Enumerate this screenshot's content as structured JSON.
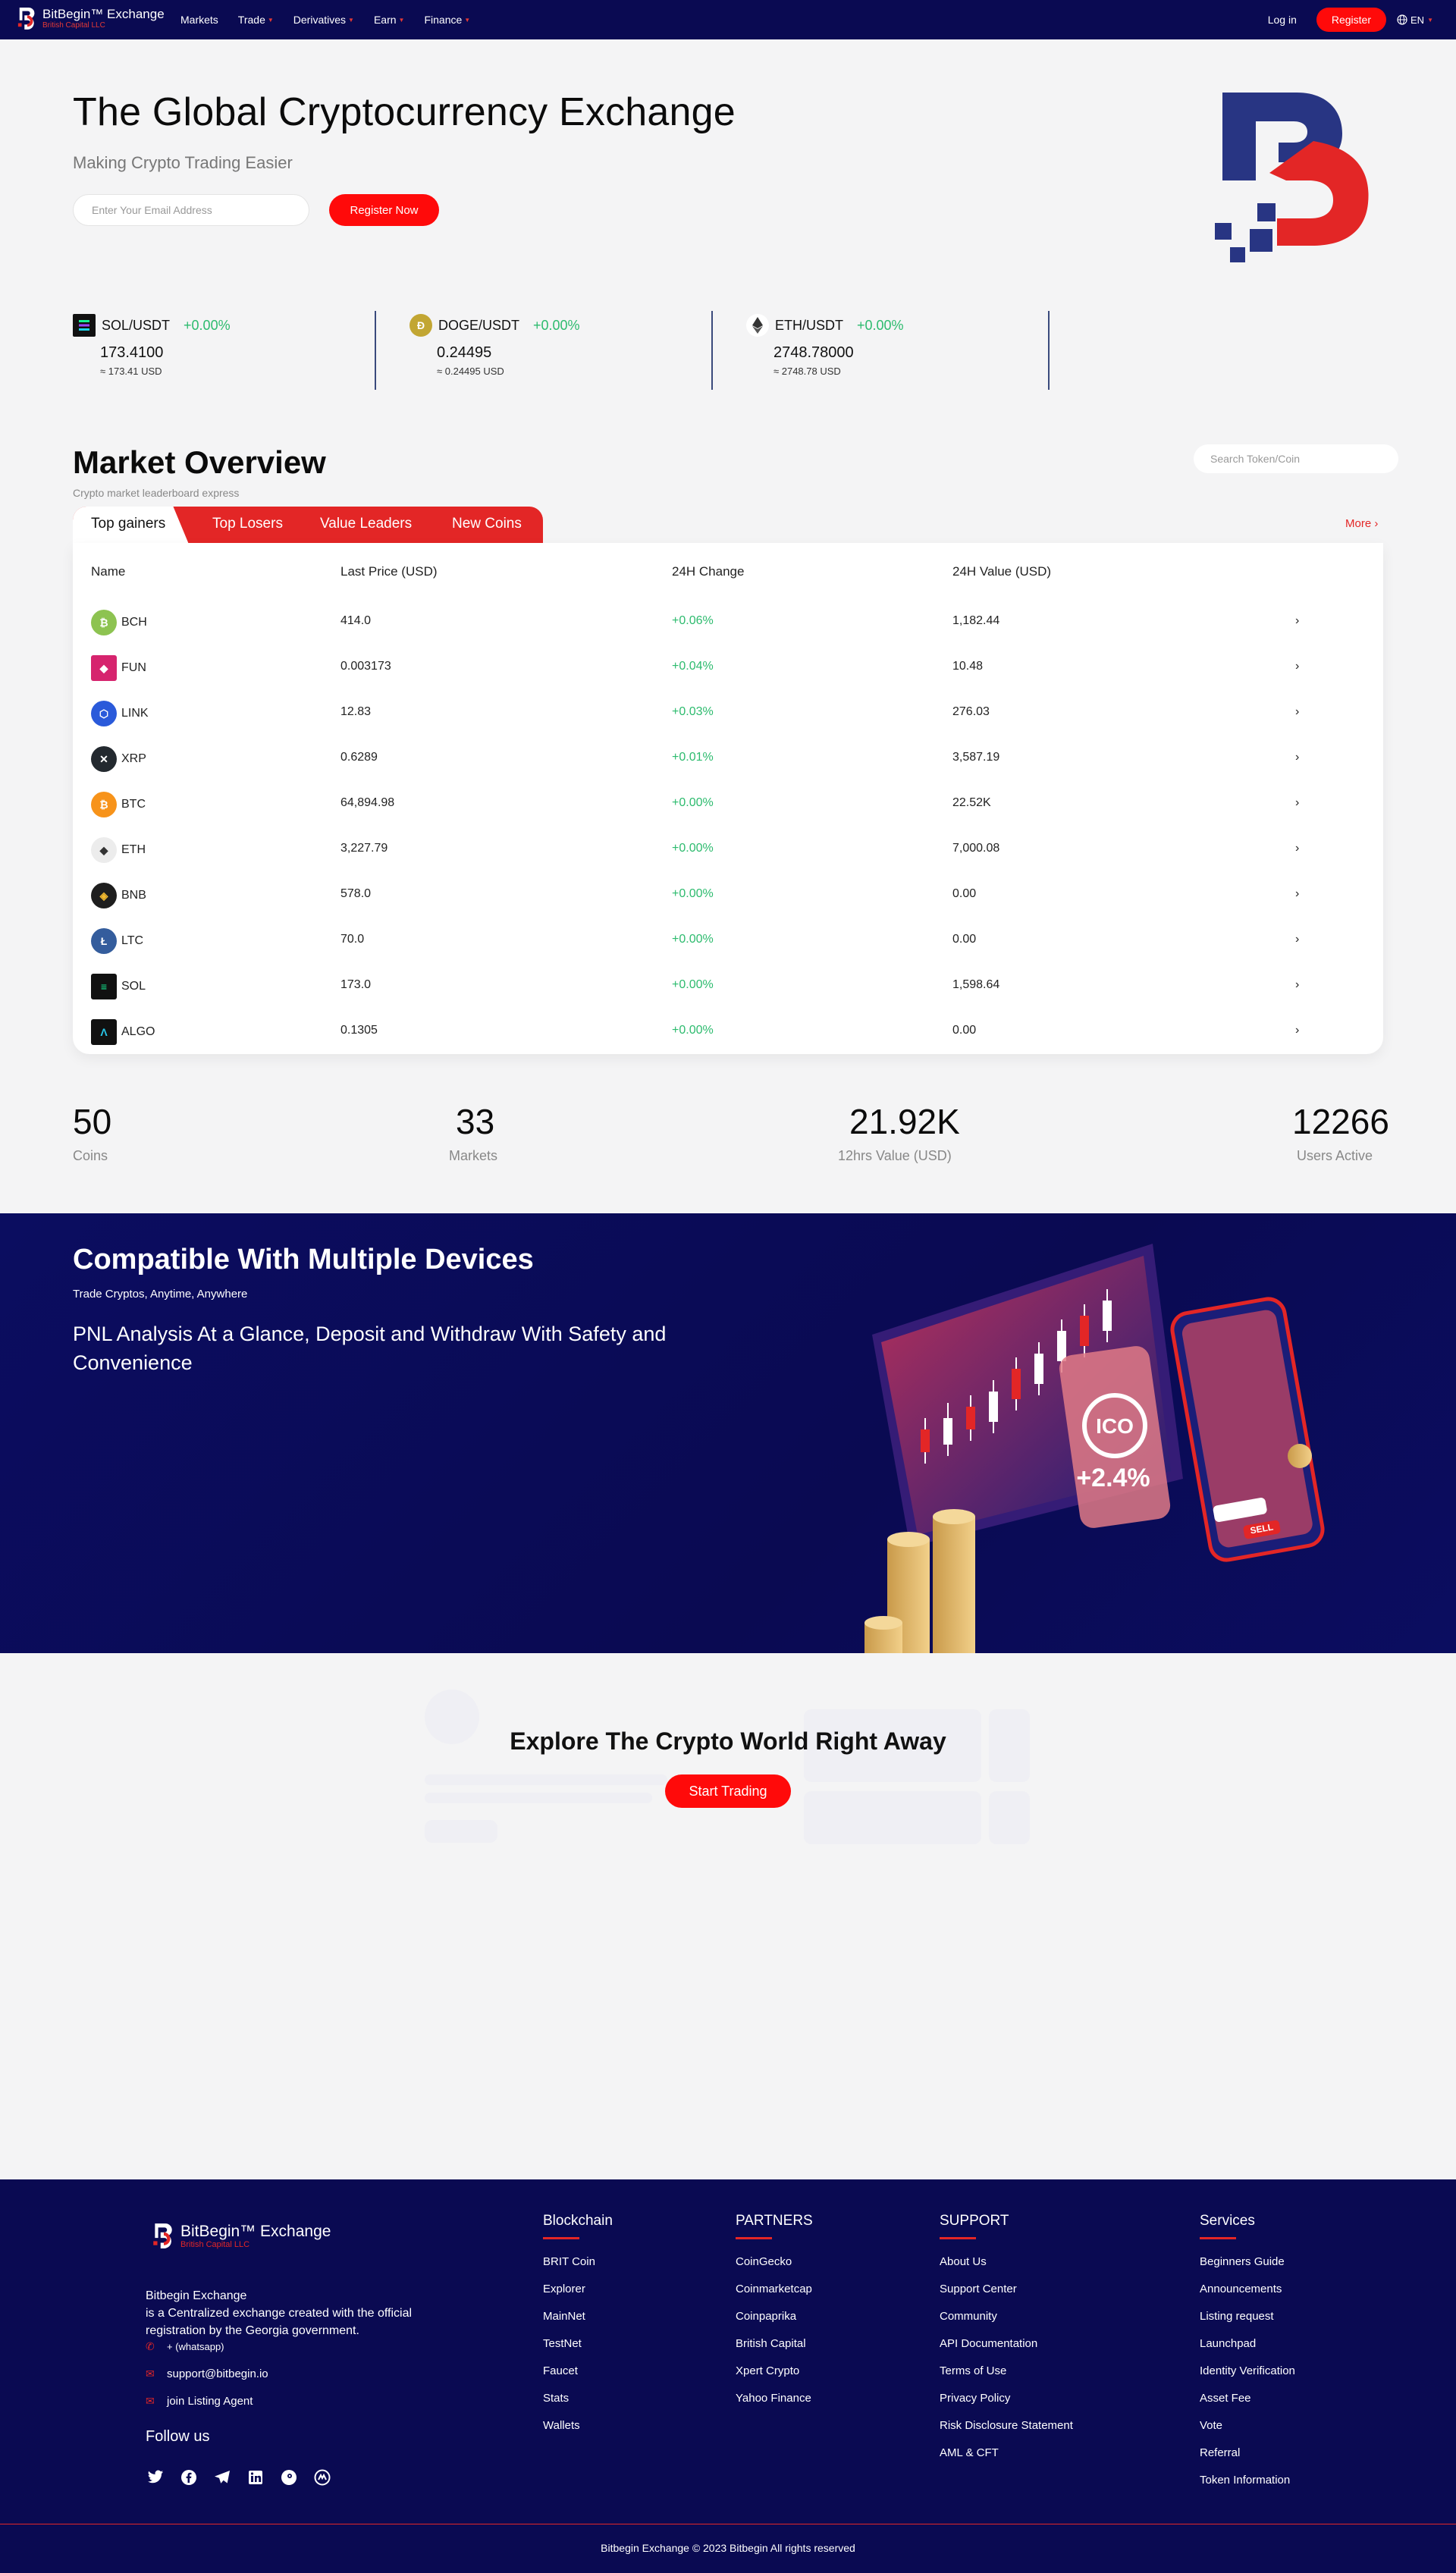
{
  "nav": {
    "brand_name": "BitBegin™ Exchange",
    "brand_sub": "British Capital LLC",
    "items": [
      {
        "label": "Markets",
        "caret": false
      },
      {
        "label": "Trade",
        "caret": true
      },
      {
        "label": "Derivatives",
        "caret": true
      },
      {
        "label": "Earn",
        "caret": true
      },
      {
        "label": "Finance",
        "caret": true
      }
    ],
    "login": "Log in",
    "register": "Register",
    "lang": "EN"
  },
  "hero": {
    "title": "The Global Cryptocurrency Exchange",
    "subtitle": "Making Crypto Trading Easier",
    "email_placeholder": "Enter Your Email Address",
    "cta": "Register Now"
  },
  "tickers": [
    {
      "pair": "SOL/USDT",
      "change": "+0.00%",
      "price": "173.4100",
      "usd": "≈ 173.41 USD",
      "icon": "sol-icon"
    },
    {
      "pair": "DOGE/USDT",
      "change": "+0.00%",
      "price": "0.24495",
      "usd": "≈ 0.24495 USD",
      "icon": "doge-icon"
    },
    {
      "pair": "ETH/USDT",
      "change": "+0.00%",
      "price": "2748.78000",
      "usd": "≈ 2748.78 USD",
      "icon": "eth-icon"
    }
  ],
  "market": {
    "title": "Market Overview",
    "subtitle": "Crypto market leaderboard express",
    "search_placeholder": "Search Token/Coin",
    "tabs": [
      "Top gainers",
      "Top Losers",
      "Value Leaders",
      "New Coins"
    ],
    "more": "More ›",
    "headers": [
      "Name",
      "Last Price (USD)",
      "24H Change",
      "24H Value (USD)"
    ],
    "rows": [
      {
        "name": "BCH",
        "price": "414.0",
        "change": "+0.06%",
        "value": "1,182.44"
      },
      {
        "name": "FUN",
        "price": "0.003173",
        "change": "+0.04%",
        "value": "10.48"
      },
      {
        "name": "LINK",
        "price": "12.83",
        "change": "+0.03%",
        "value": "276.03"
      },
      {
        "name": "XRP",
        "price": "0.6289",
        "change": "+0.01%",
        "value": "3,587.19"
      },
      {
        "name": "BTC",
        "price": "64,894.98",
        "change": "+0.00%",
        "value": "22.52K"
      },
      {
        "name": "ETH",
        "price": "3,227.79",
        "change": "+0.00%",
        "value": "7,000.08"
      },
      {
        "name": "BNB",
        "price": "578.0",
        "change": "+0.00%",
        "value": "0.00"
      },
      {
        "name": "LTC",
        "price": "70.0",
        "change": "+0.00%",
        "value": "0.00"
      },
      {
        "name": "SOL",
        "price": "173.0",
        "change": "+0.00%",
        "value": "1,598.64"
      },
      {
        "name": "ALGO",
        "price": "0.1305",
        "change": "+0.00%",
        "value": "0.00"
      }
    ],
    "row_arrow": "›"
  },
  "stats": [
    {
      "value": "50",
      "label": "Coins"
    },
    {
      "value": "33",
      "label": "Markets"
    },
    {
      "value": "21.92K",
      "label": "12hrs Value (USD)"
    },
    {
      "value": "12266",
      "label": "Users Active"
    }
  ],
  "devices": {
    "title": "Compatible With Multiple Devices",
    "subtitle": "Trade Cryptos, Anytime, Anywhere",
    "desc": "PNL Analysis At a Glance, Deposit and Withdraw With Safety and Convenience",
    "art_ico": "ICO",
    "art_pct": "+2.4%",
    "art_sell": "SELL"
  },
  "explore": {
    "title": "Explore The Crypto World Right Away",
    "cta": "Start Trading"
  },
  "footer": {
    "brand_name": "BitBegin™ Exchange",
    "brand_sub": "British Capital LLC",
    "about_title": "Bitbegin Exchange",
    "about": "is a Centralized exchange created with the official registration by the Georgia government.",
    "phone": "+ (whatsapp)",
    "email": "support@bitbegin.io",
    "listing": "join Listing Agent",
    "follow": "Follow us",
    "columns": [
      {
        "title": "Blockchain",
        "links": [
          "BRIT Coin",
          "Explorer",
          "MainNet",
          "TestNet",
          "Faucet",
          "Stats",
          "Wallets"
        ]
      },
      {
        "title": "PARTNERS",
        "links": [
          "CoinGecko",
          "Coinmarketcap",
          "Coinpaprika",
          "British Capital",
          "Xpert Crypto",
          "Yahoo Finance"
        ]
      },
      {
        "title": "SUPPORT",
        "links": [
          "About Us",
          "Support Center",
          "Community",
          "API Documentation",
          "Terms of Use",
          "Privacy Policy",
          "Risk Disclosure Statement",
          "AML & CFT"
        ]
      },
      {
        "title": "Services",
        "links": [
          "Beginners Guide",
          "Announcements",
          "Listing request",
          "Launchpad",
          "Identity Verification",
          "Asset Fee",
          "Vote",
          "Referral",
          "Token Information"
        ]
      }
    ],
    "copyright": "Bitbegin Exchange © 2023 Bitbegin All rights reserved"
  },
  "colors": {
    "navy": "#0a0a52",
    "accent_red": "#ff0a0a",
    "positive": "#2dbb6e"
  }
}
